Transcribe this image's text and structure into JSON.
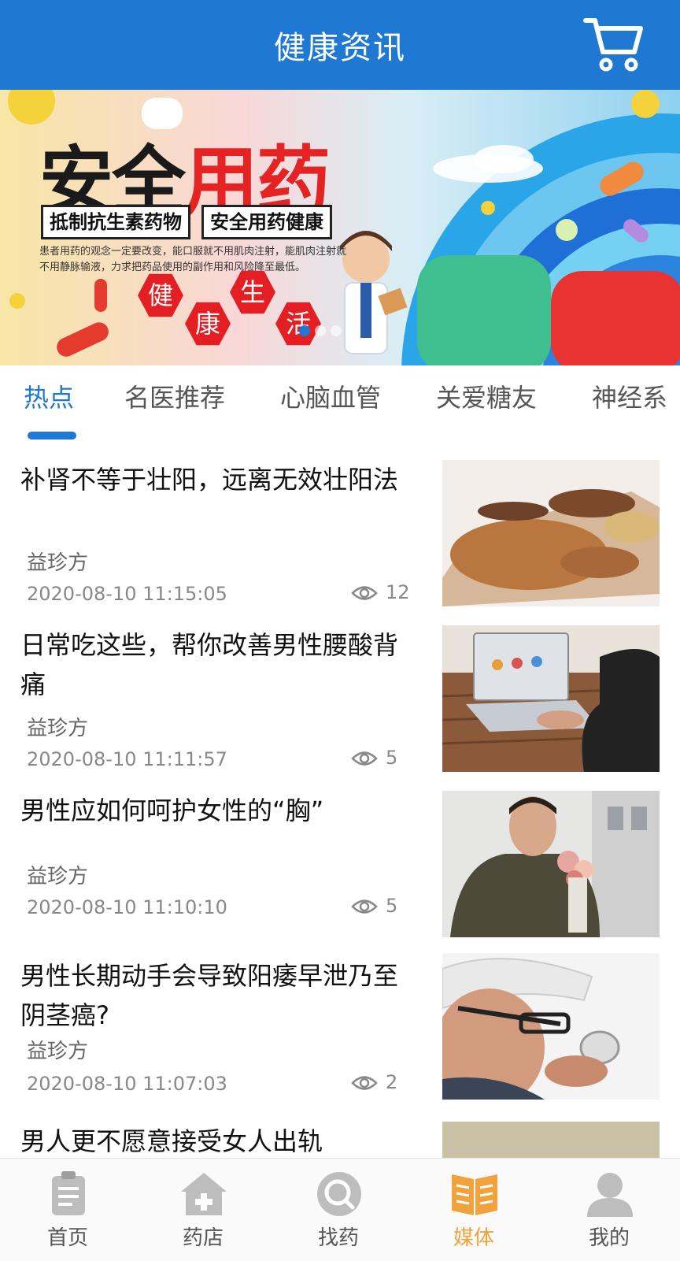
{
  "header": {
    "title": "健康资讯",
    "cart_icon": "cart-icon"
  },
  "banner": {
    "title_part1": "安全",
    "title_part2": "用药",
    "tag1": "抵制抗生素药物",
    "tag2": "安全用药健康",
    "description": "患者用药的观念一定要改变，能口服就不用肌肉注射，能肌肉注射就不用静脉输液，力求把药品使用的副作用和风险降至最低。",
    "hex1": "健",
    "hex2": "康",
    "hex3": "生",
    "hex4": "活",
    "active_slide": 1,
    "slide_count": 3
  },
  "tabs": [
    {
      "label": "热点",
      "active": true
    },
    {
      "label": "名医推荐",
      "active": false
    },
    {
      "label": "心脑血管",
      "active": false
    },
    {
      "label": "关爱糖友",
      "active": false
    },
    {
      "label": "神经系",
      "active": false
    }
  ],
  "articles": [
    {
      "title": "补肾不等于壮阳，远离无效壮阳法",
      "source": "益珍方",
      "date": "2020-08-10 11:15:05",
      "views": "12",
      "thumb": "nuts-photo"
    },
    {
      "title": "日常吃这些，帮你改善男性腰酸背痛",
      "source": "益珍方",
      "date": "2020-08-10 11:11:57",
      "views": "5",
      "thumb": "laptop-photo"
    },
    {
      "title": "男性应如何呵护女性的“胸”",
      "source": "益珍方",
      "date": "2020-08-10 11:10:10",
      "views": "5",
      "thumb": "man-flowers-photo"
    },
    {
      "title": "男性长期动手会导致阳痿早泄乃至阴茎癌?",
      "source": "益珍方",
      "date": "2020-08-10 11:07:03",
      "views": "2",
      "thumb": "man-helmet-photo"
    },
    {
      "title": "男人更不愿意接受女人出轨",
      "source": "",
      "date": "",
      "views": "",
      "thumb": "partial-photo"
    }
  ],
  "tabbar": [
    {
      "label": "首页",
      "icon": "clipboard-icon",
      "active": false
    },
    {
      "label": "药店",
      "icon": "pharmacy-icon",
      "active": false
    },
    {
      "label": "找药",
      "icon": "search-icon",
      "active": false
    },
    {
      "label": "媒体",
      "icon": "book-icon",
      "active": true
    },
    {
      "label": "我的",
      "icon": "user-icon",
      "active": false
    }
  ],
  "colors": {
    "primary": "#1f78d1",
    "accent_orange": "#f0a23c",
    "banner_red": "#e31f24"
  }
}
